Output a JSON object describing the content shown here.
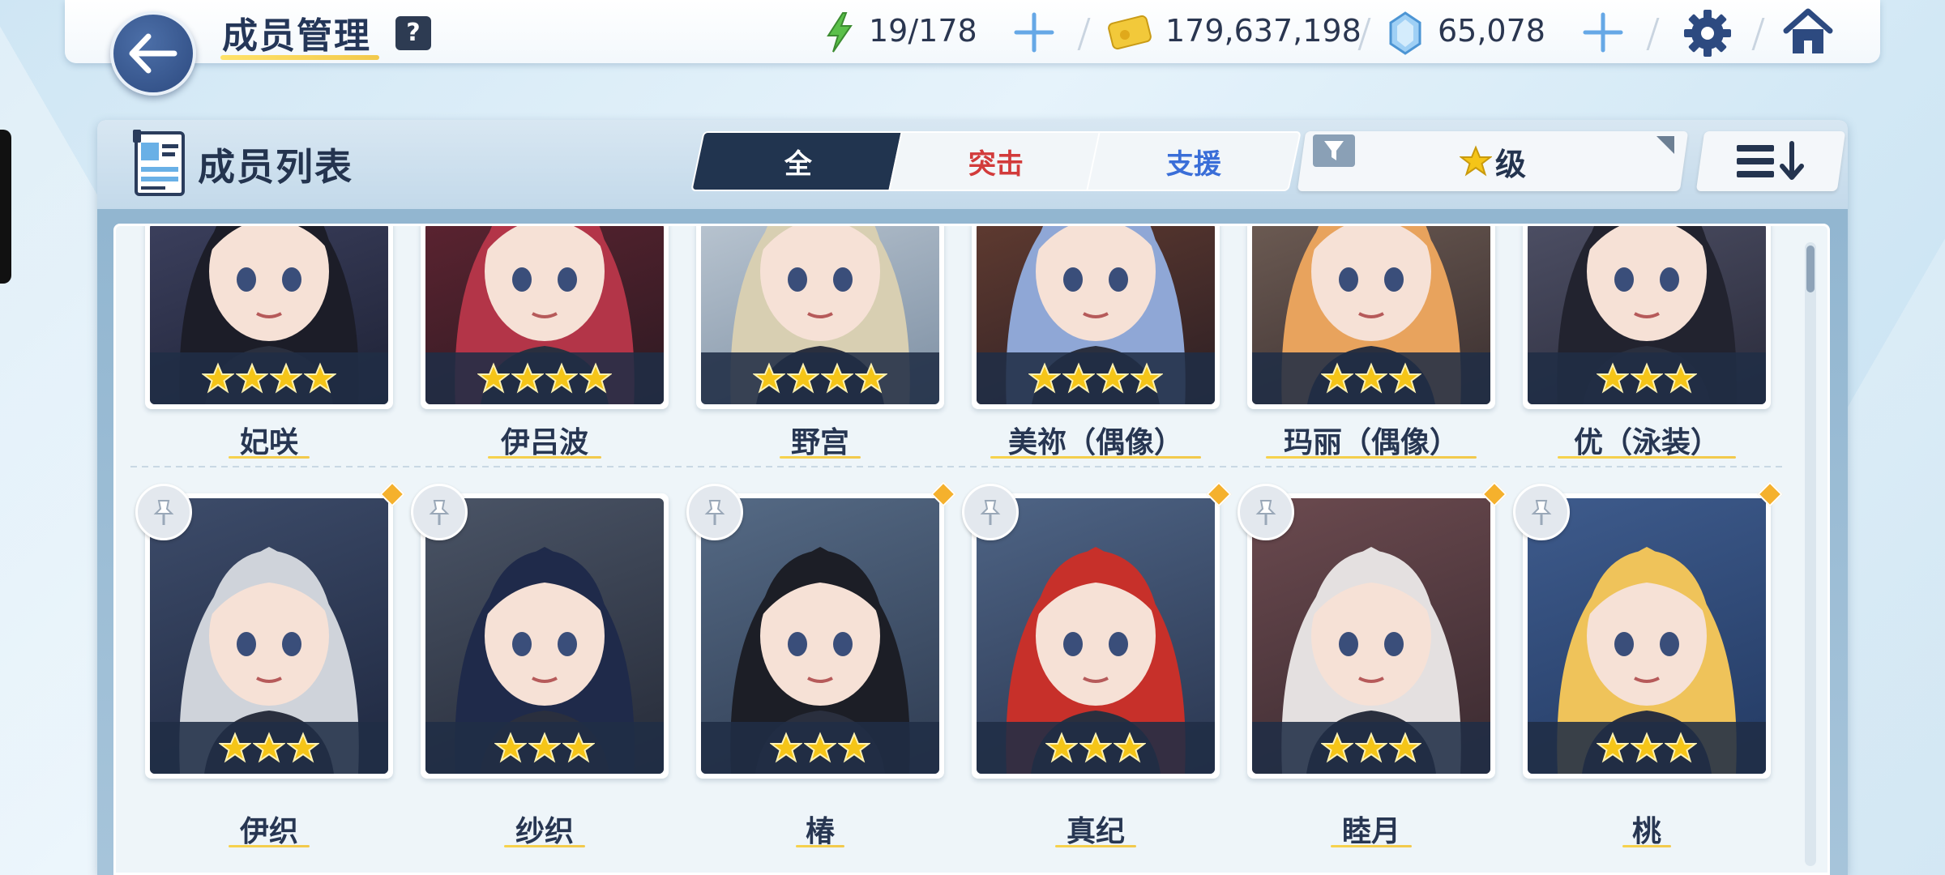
{
  "header": {
    "title": "成员管理",
    "help": "?",
    "ap": "19/178",
    "credits": "179,637,198",
    "gems": "65,078"
  },
  "panel": {
    "title": "成员列表",
    "tabs": [
      {
        "label": "全",
        "active": true
      },
      {
        "label": "突击",
        "active": false
      },
      {
        "label": "支援",
        "active": false
      }
    ],
    "filter_label": "级",
    "colors": {
      "accent": "#21344f",
      "striker": "#d23b3b",
      "special": "#3a6ed8",
      "star": "#f5c518",
      "new": "#f5b12d"
    }
  },
  "students": [
    {
      "name": "妃咲",
      "stars": 4,
      "bg": [
        "#3b3f5c",
        "#1e2236"
      ],
      "hair": "#1c1d28",
      "pinned": false,
      "new": false
    },
    {
      "name": "伊吕波",
      "stars": 4,
      "bg": [
        "#5a2330",
        "#2d1a22"
      ],
      "hair": "#b33548",
      "pinned": false,
      "new": false
    },
    {
      "name": "野宫",
      "stars": 4,
      "bg": [
        "#b7c3cf",
        "#7d8fa3"
      ],
      "hair": "#d8cfb2",
      "pinned": false,
      "new": false
    },
    {
      "name": "美祢（偶像）",
      "stars": 4,
      "bg": [
        "#5e3a30",
        "#2d1f24"
      ],
      "hair": "#8fa7d6",
      "pinned": false,
      "new": false
    },
    {
      "name": "玛丽（偶像）",
      "stars": 3,
      "bg": [
        "#6b5a52",
        "#3a2f30"
      ],
      "hair": "#e8a35d",
      "pinned": false,
      "new": false
    },
    {
      "name": "优（泳装）",
      "stars": 3,
      "bg": [
        "#4c4e63",
        "#2a2b3b"
      ],
      "hair": "#22232f",
      "pinned": false,
      "new": false
    },
    {
      "name": "伊织",
      "stars": 3,
      "bg": [
        "#3d4c6a",
        "#1f2840"
      ],
      "hair": "#cfd3da",
      "pinned": true,
      "new": true
    },
    {
      "name": "纱织",
      "stars": 3,
      "bg": [
        "#4a5466",
        "#262b38"
      ],
      "hair": "#1f2a4a",
      "pinned": true,
      "new": false
    },
    {
      "name": "椿",
      "stars": 3,
      "bg": [
        "#556a85",
        "#2f3c52"
      ],
      "hair": "#1c1e26",
      "pinned": true,
      "new": true
    },
    {
      "name": "真纪",
      "stars": 3,
      "bg": [
        "#4e6485",
        "#2a3650"
      ],
      "hair": "#c7302a",
      "pinned": true,
      "new": true
    },
    {
      "name": "睦月",
      "stars": 3,
      "bg": [
        "#6b4a4f",
        "#3a2a30"
      ],
      "hair": "#e4e0e0",
      "pinned": true,
      "new": true
    },
    {
      "name": "桃",
      "stars": 3,
      "bg": [
        "#3e5b8c",
        "#233a63"
      ],
      "hair": "#efc35a",
      "pinned": true,
      "new": true
    }
  ]
}
